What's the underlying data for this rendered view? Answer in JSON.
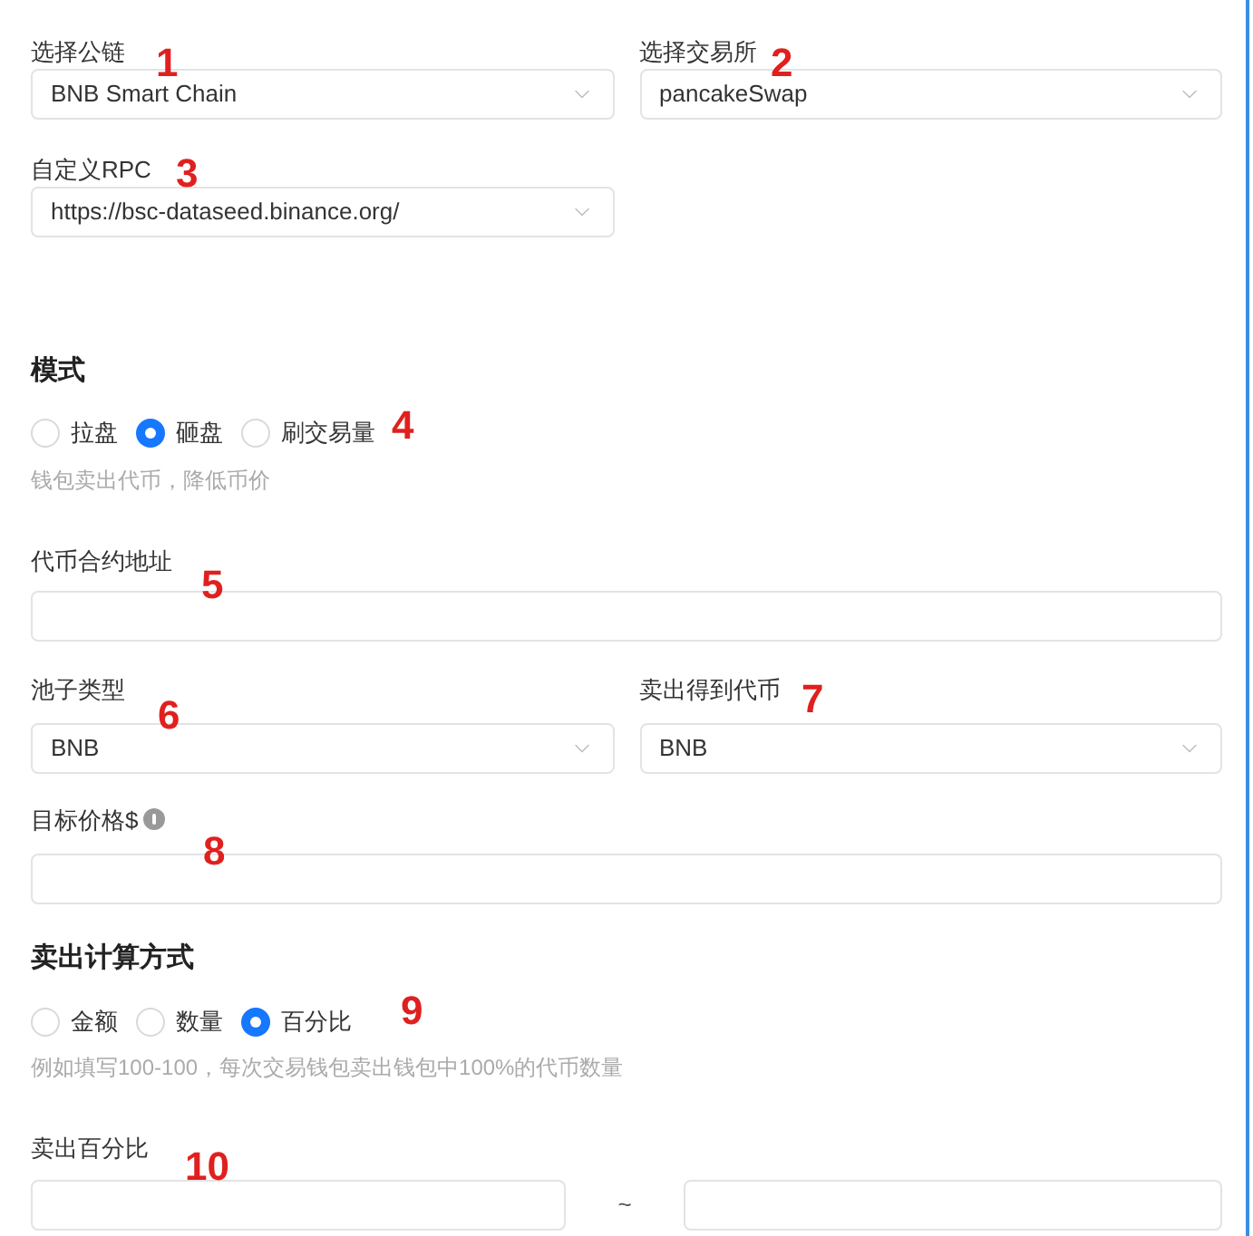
{
  "chain": {
    "label": "选择公链",
    "value": "BNB Smart Chain"
  },
  "exchange": {
    "label": "选择交易所",
    "value": "pancakeSwap"
  },
  "rpc": {
    "label": "自定义RPC",
    "value": "https://bsc-dataseed.binance.org/"
  },
  "mode": {
    "title": "模式",
    "options": [
      {
        "label": "拉盘",
        "selected": false
      },
      {
        "label": "砸盘",
        "selected": true
      },
      {
        "label": "刷交易量",
        "selected": false
      }
    ],
    "hint": "钱包卖出代币，降低币价"
  },
  "token_address": {
    "label": "代币合约地址"
  },
  "pool_type": {
    "label": "池子类型",
    "value": "BNB"
  },
  "sell_token": {
    "label": "卖出得到代币",
    "value": "BNB"
  },
  "target_price": {
    "label": "目标价格$"
  },
  "sell_method": {
    "title": "卖出计算方式",
    "options": [
      {
        "label": "金额",
        "selected": false
      },
      {
        "label": "数量",
        "selected": false
      },
      {
        "label": "百分比",
        "selected": true
      }
    ],
    "hint": "例如填写100-100，每次交易钱包卖出钱包中100%的代币数量"
  },
  "sell_percent": {
    "label": "卖出百分比",
    "separator": "~"
  },
  "annotations": [
    "1",
    "2",
    "3",
    "4",
    "5",
    "6",
    "7",
    "8",
    "9",
    "10"
  ]
}
